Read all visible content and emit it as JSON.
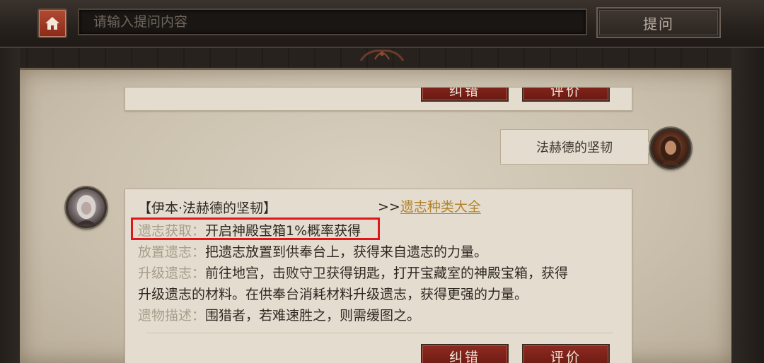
{
  "header": {
    "search_placeholder": "请输入提问内容",
    "ask_label": "提问"
  },
  "previous_answer": {
    "correct_label": "纠错",
    "rate_label": "评价"
  },
  "user_message": {
    "text": "法赫德的坚韧"
  },
  "answer": {
    "title": "【伊本·法赫德的坚韧】",
    "link_prefix": ">>",
    "link_text": "遗志种类大全",
    "rows": [
      {
        "label": "遗志获取：",
        "value": "开启神殿宝箱1%概率获得"
      },
      {
        "label": "放置遗志：",
        "value": "把遗志放置到供奉台上，获得来自遗志的力量。"
      },
      {
        "label": "升级遗志：",
        "value": "前往地宫，击败守卫获得钥匙，打开宝藏室的神殿宝箱，获得"
      },
      {
        "label": "",
        "value": "升级遗志的材料。在供奉台消耗材料升级遗志，获得更强的力量。"
      },
      {
        "label": "遗物描述：",
        "value": "围猎者，若难速胜之，则需缓图之。"
      }
    ],
    "correct_label": "纠错",
    "rate_label": "评价"
  },
  "colors": {
    "accent_red": "#8e2a20",
    "highlight_border": "#e0161a",
    "link": "#b3832d",
    "parchment": "#cbc1ae"
  },
  "icons": {
    "home": "home-icon",
    "ornament": "ornament-icon"
  }
}
